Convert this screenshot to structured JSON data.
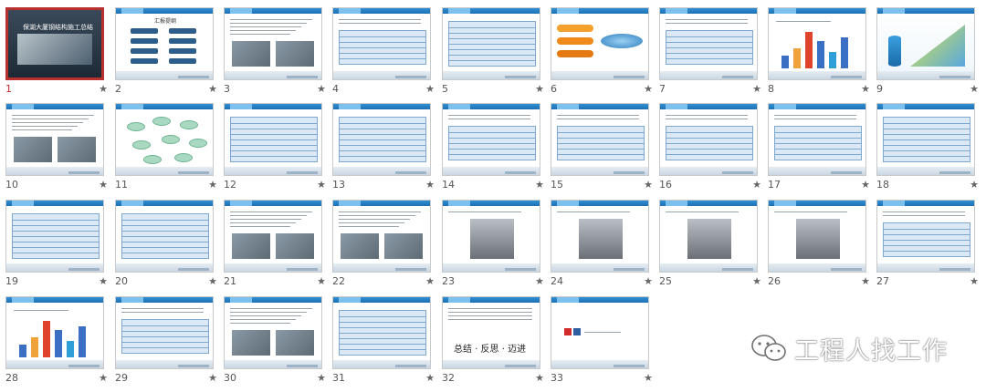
{
  "view": "slide-sorter",
  "selected_slide": 1,
  "slides": [
    {
      "number": "1",
      "kind": "title-image",
      "title_text": "保湖大厦钢结构施工总结"
    },
    {
      "number": "2",
      "kind": "menu-buttons",
      "title_text": "汇报提纲"
    },
    {
      "number": "3",
      "kind": "text-images"
    },
    {
      "number": "4",
      "kind": "text-table"
    },
    {
      "number": "5",
      "kind": "table"
    },
    {
      "number": "6",
      "kind": "disk-diagram"
    },
    {
      "number": "7",
      "kind": "text-table"
    },
    {
      "number": "8",
      "kind": "chart-bars"
    },
    {
      "number": "9",
      "kind": "chart-3d"
    },
    {
      "number": "10",
      "kind": "text-images"
    },
    {
      "number": "11",
      "kind": "bubble-diagram"
    },
    {
      "number": "12",
      "kind": "table"
    },
    {
      "number": "13",
      "kind": "table"
    },
    {
      "number": "14",
      "kind": "text-table"
    },
    {
      "number": "15",
      "kind": "text-table"
    },
    {
      "number": "16",
      "kind": "text-table"
    },
    {
      "number": "17",
      "kind": "text-table"
    },
    {
      "number": "18",
      "kind": "table"
    },
    {
      "number": "19",
      "kind": "table"
    },
    {
      "number": "20",
      "kind": "table"
    },
    {
      "number": "21",
      "kind": "text-images"
    },
    {
      "number": "22",
      "kind": "text-images"
    },
    {
      "number": "23",
      "kind": "photo"
    },
    {
      "number": "24",
      "kind": "photo"
    },
    {
      "number": "25",
      "kind": "photo"
    },
    {
      "number": "26",
      "kind": "photo"
    },
    {
      "number": "27",
      "kind": "text-table"
    },
    {
      "number": "28",
      "kind": "chart-bars"
    },
    {
      "number": "29",
      "kind": "text-table"
    },
    {
      "number": "30",
      "kind": "text-images"
    },
    {
      "number": "31",
      "kind": "table"
    },
    {
      "number": "32",
      "kind": "text-slogan",
      "slogan": "总结 · 反思 · 迈进"
    },
    {
      "number": "33",
      "kind": "end"
    }
  ],
  "star_glyph": "★",
  "watermark": {
    "text": "工程人找工作",
    "icon": "wechat-icon"
  },
  "colors": {
    "selected_border": "#b8312f",
    "header_blue": "#2f8fd6",
    "selected_number": "#c42b2b"
  }
}
